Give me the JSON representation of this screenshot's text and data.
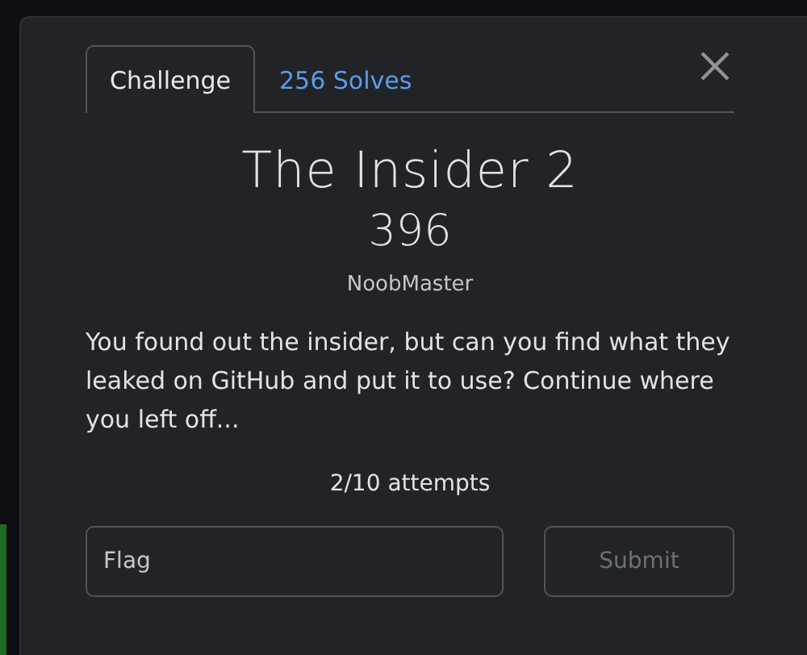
{
  "tabs": [
    {
      "label": "Challenge",
      "selected": true
    },
    {
      "label": "256 Solves",
      "selected": false
    }
  ],
  "challenge": {
    "title": "The Insider 2",
    "points": "396",
    "author": "NoobMaster",
    "description": "You found out the insider, but can you find what they leaked on GitHub and put it to use? Continue where you left off...",
    "attempts": "2/10 attempts"
  },
  "flag_field": {
    "placeholder": "Flag"
  },
  "submit_button": {
    "label": "Submit",
    "disabled": true
  }
}
